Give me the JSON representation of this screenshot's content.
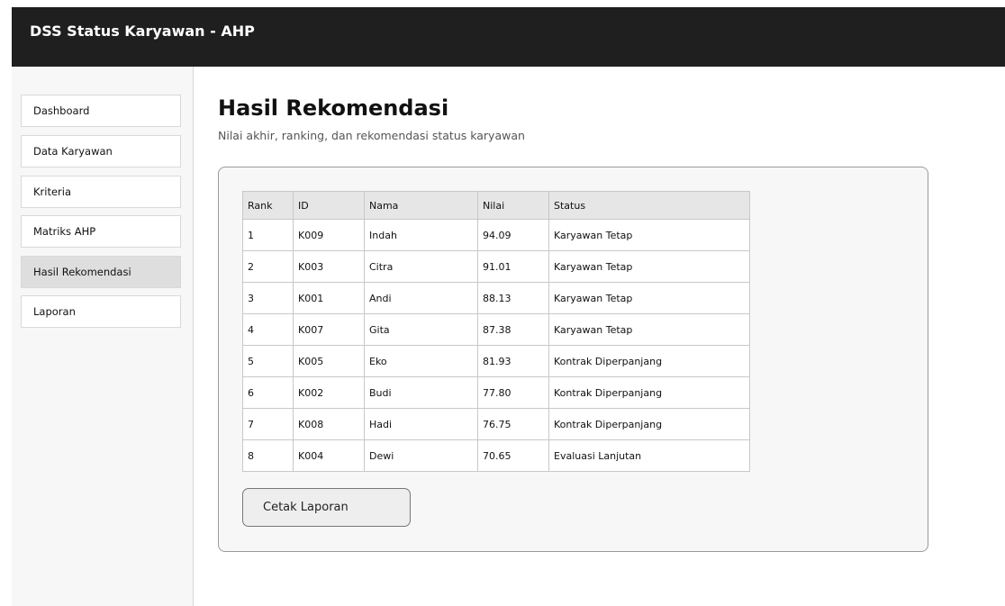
{
  "header": {
    "title": "DSS Status Karyawan - AHP"
  },
  "sidebar": {
    "items": [
      {
        "label": "Dashboard",
        "active": false
      },
      {
        "label": "Data Karyawan",
        "active": false
      },
      {
        "label": "Kriteria",
        "active": false
      },
      {
        "label": "Matriks AHP",
        "active": false
      },
      {
        "label": "Hasil Rekomendasi",
        "active": true
      },
      {
        "label": "Laporan",
        "active": false
      }
    ]
  },
  "main": {
    "title": "Hasil Rekomendasi",
    "subtitle": "Nilai akhir, ranking, dan rekomendasi status karyawan",
    "table": {
      "columns": [
        "Rank",
        "ID",
        "Nama",
        "Nilai",
        "Status"
      ],
      "rows": [
        [
          "1",
          "K009",
          "Indah",
          "94.09",
          "Karyawan Tetap"
        ],
        [
          "2",
          "K003",
          "Citra",
          "91.01",
          "Karyawan Tetap"
        ],
        [
          "3",
          "K001",
          "Andi",
          "88.13",
          "Karyawan Tetap"
        ],
        [
          "4",
          "K007",
          "Gita",
          "87.38",
          "Karyawan Tetap"
        ],
        [
          "5",
          "K005",
          "Eko",
          "81.93",
          "Kontrak Diperpanjang"
        ],
        [
          "6",
          "K002",
          "Budi",
          "77.80",
          "Kontrak Diperpanjang"
        ],
        [
          "7",
          "K008",
          "Hadi",
          "76.75",
          "Kontrak Diperpanjang"
        ],
        [
          "8",
          "K004",
          "Dewi",
          "70.65",
          "Evaluasi Lanjutan"
        ]
      ]
    },
    "print_button_label": "Cetak Laporan"
  },
  "colors": {
    "header_bg": "#1f1f1f",
    "sidebar_active_bg": "#dedede",
    "table_header_bg": "#e6e6e6"
  }
}
